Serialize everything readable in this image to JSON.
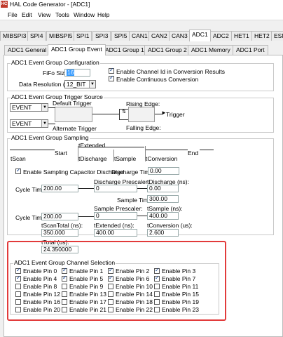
{
  "window": {
    "app_icon_text": "HC",
    "title": "HAL Code Generator  - [ADC1]"
  },
  "menu": [
    "File",
    "Edit",
    "View",
    "Tools",
    "Window",
    "Help"
  ],
  "module_tabs": [
    "MIBSPI3",
    "SPI4",
    "MIBSPI5",
    "SPI1",
    "SPI3",
    "SPI5",
    "CAN1",
    "CAN2",
    "CAN3",
    "ADC1",
    "ADC2",
    "HET1",
    "HET2",
    "ESM"
  ],
  "module_tab_active": "ADC1",
  "sub_tabs": [
    "ADC1 General",
    "ADC1 Group Event",
    "ADC1 Group 1",
    "ADC1 Group 2",
    "ADC1 Memory",
    "ADC1 Port"
  ],
  "sub_tab_active": "ADC1 Group Event",
  "config": {
    "title": "ADC1 Event Group Configuration",
    "fifo_label": "FiFo Size:",
    "fifo_value": "16",
    "resolution_label": "Data Resolution (Bit):",
    "resolution_value": "12_BIT",
    "enable_channel_id": "Enable Channel Id in Conversion Results",
    "enable_continuous": "Enable Continuous Conversion"
  },
  "trigger": {
    "title": "ADC1 Event Group Trigger Source",
    "source1": "EVENT",
    "source2": "EVENT",
    "default_trigger": "Default Trigger",
    "alternate_trigger": "Alternate Trigger",
    "rising_edge": "Rising Edge:",
    "falling_edge": "Falling Edge:",
    "trigger_label": "Trigger"
  },
  "sampling": {
    "title": "ADC1 Event Group Sampling",
    "extended": "tExtended",
    "start": "Start",
    "end": "End",
    "scan": "tScan",
    "discharge": "tDischarge",
    "sample": "tSample",
    "conversion": "tConversion",
    "enable_cap_discharge": "Enable Sampling Capacitor Discharge",
    "discharge_time_label": "Discharge Time:",
    "discharge_time_value": "0.00",
    "discharge_prescaler_label": "Discharge Prescaler:",
    "tdischarge_ns_label": "tDischarge (ns):",
    "cycle_time_label_1": "Cycle Time:",
    "cycle_time_value_1": "200.00",
    "discharge_prescaler_value": "0",
    "tdischarge_ns_value": "0.00",
    "sample_time_label": "Sample Time:",
    "sample_time_value": "300.00",
    "sample_prescaler_label": "Sample Prescaler:",
    "tsample_ns_label": "tSample (ns):",
    "cycle_time_label_2": "Cycle Time:",
    "cycle_time_value_2": "200.00",
    "sample_prescaler_value": "0",
    "tsample_ns_value": "400.00",
    "tscantotal_label": "tScanTotal (ns):",
    "tscantotal_value": "350.000",
    "textended_ns_label": "tExtended (ns):",
    "textended_ns_value": "400.00",
    "tconversion_label": "tConversion (us):",
    "tconversion_value": "2.600",
    "ttotal_label": "tTotal (us):",
    "ttotal_value": "24.350000"
  },
  "channels": {
    "title": "ADC1 Event Group Channel Selection",
    "pins": [
      {
        "label": "Enable Pin 0",
        "checked": true
      },
      {
        "label": "Enable Pin 1",
        "checked": true
      },
      {
        "label": "Enable Pin 2",
        "checked": true
      },
      {
        "label": "Enable Pin 3",
        "checked": true
      },
      {
        "label": "Enable Pin 4",
        "checked": true
      },
      {
        "label": "Enable Pin 5",
        "checked": true
      },
      {
        "label": "Enable Pin 6",
        "checked": true
      },
      {
        "label": "Enable Pin 7",
        "checked": true
      },
      {
        "label": "Enable Pin 8",
        "checked": false
      },
      {
        "label": "Enable Pin 9",
        "checked": false
      },
      {
        "label": "Enable Pin 10",
        "checked": false
      },
      {
        "label": "Enable Pin 11",
        "checked": false
      },
      {
        "label": "Enable Pin 12",
        "checked": false
      },
      {
        "label": "Enable Pin 13",
        "checked": false
      },
      {
        "label": "Enable Pin 14",
        "checked": false
      },
      {
        "label": "Enable Pin 15",
        "checked": false
      },
      {
        "label": "Enable Pin 16",
        "checked": false
      },
      {
        "label": "Enable Pin 17",
        "checked": false
      },
      {
        "label": "Enable Pin 18",
        "checked": false
      },
      {
        "label": "Enable Pin 19",
        "checked": false
      },
      {
        "label": "Enable Pin 20",
        "checked": false
      },
      {
        "label": "Enable Pin 21",
        "checked": false
      },
      {
        "label": "Enable Pin 22",
        "checked": false
      },
      {
        "label": "Enable Pin 23",
        "checked": false
      }
    ]
  },
  "colors": {
    "highlight": "#e23b3b",
    "check": "#0b3c8c",
    "app_icon": "#c0392b"
  }
}
